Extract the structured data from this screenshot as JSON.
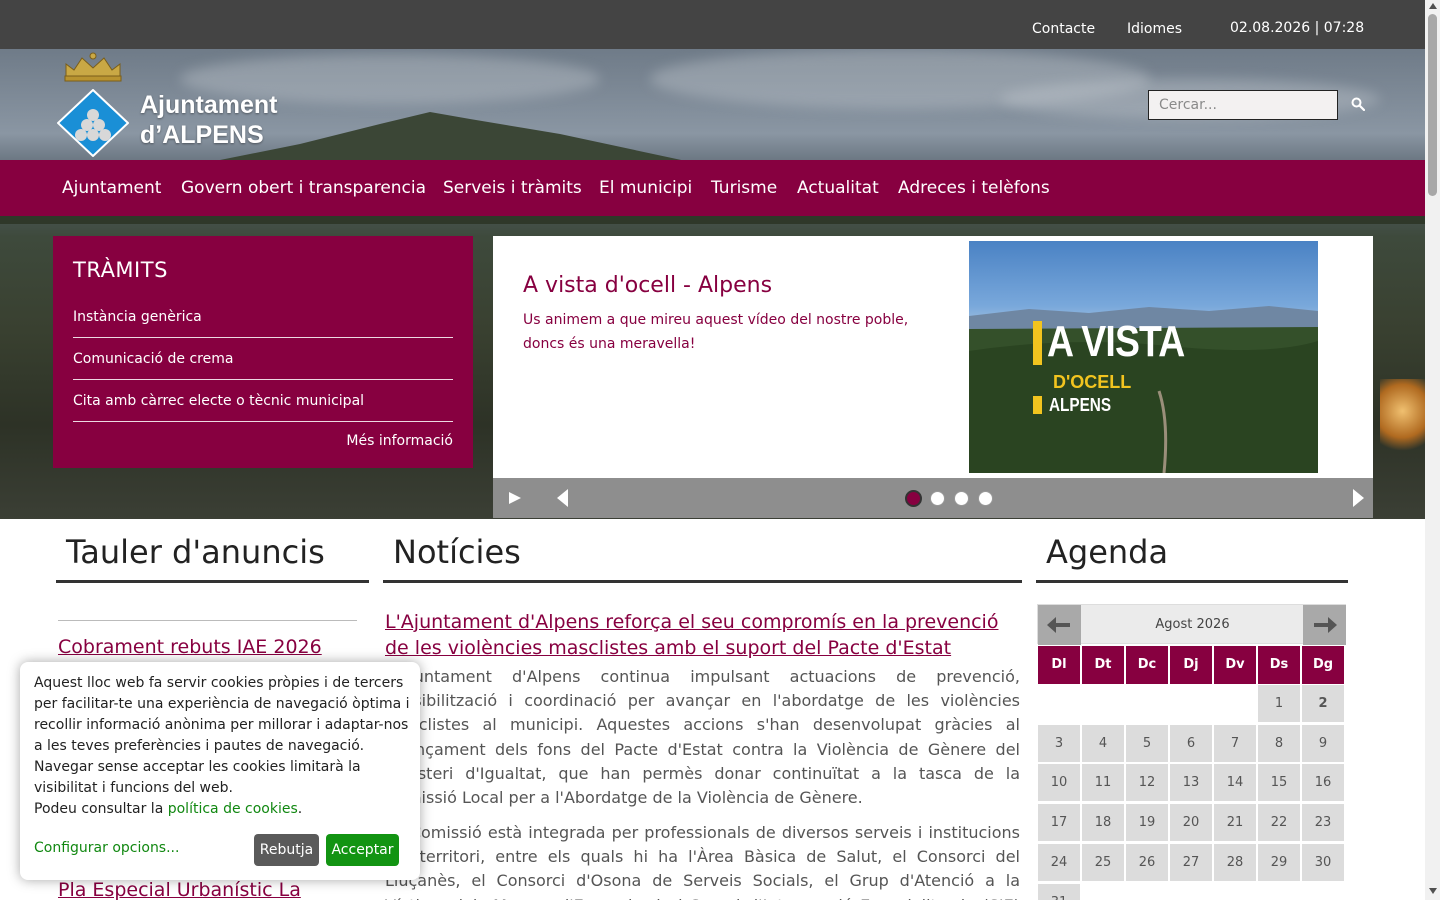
{
  "topbar": {
    "contact_label": "Contacte",
    "languages_label": "Idiomes",
    "datetime": "02.08.2026 | 07:28"
  },
  "header": {
    "logo_line1": "Ajuntament",
    "logo_line2": "d’ALPENS",
    "search_placeholder": "Cercar...",
    "search_icon": "search-icon"
  },
  "nav": {
    "items": [
      "Ajuntament",
      "Govern obert i transparencia",
      "Serveis i tràmits",
      "El municipi",
      "Turisme",
      "Actualitat",
      "Adreces i telèfons"
    ]
  },
  "tramits": {
    "title": "TRÀMITS",
    "items": [
      "Instància genèrica",
      "Comunicació de crema",
      "Cita amb càrrec electe o tècnic municipal"
    ],
    "more_label": "Més informació"
  },
  "slider": {
    "title": "A vista d'ocell - Alpens",
    "description": "Us animem a que mireu aquest vídeo del nostre poble, doncs és una meravella!",
    "image_text": {
      "line1": "A VISTA",
      "line2": "D'OCELL",
      "line3": "ALPENS"
    },
    "dot_count": 4,
    "active_dot": 0
  },
  "tauler": {
    "heading": "Tauler d'anuncis",
    "items": [
      "Cobrament rebuts IAE 2026",
      "Pla Especial Urbanístic La"
    ]
  },
  "noticies": {
    "heading": "Notícies",
    "title": "L'Ajuntament d'Alpens reforça el seu compromís en la prevenció de les violències masclistes amb el suport del Pacte d'Estat",
    "paragraph1": "L'Ajuntament d'Alpens continua impulsant actuacions de prevenció, sensibilització i coordinació per avançar en l'abordatge de les violències masclistes al municipi. Aquestes accions s'han desenvolupat gràcies al finançament dels fons del Pacte d'Estat contra la Violència de Gènere del Ministeri d'Igualtat, que han permès donar continuïtat a la tasca de la Comissió Local per a l'Abordatge de la Violència de Gènere.",
    "paragraph2": "La Comissió està integrada per professionals de diversos serveis i institucions del territori, entre els quals hi ha l'Àrea Bàsica de Salut, el Consorci del Lluçanès, el Consorci d'Osona de Serveis Socials, el Grup d'Atenció a la Víctima dels Mossos d'Esquadra i el Servei d'Intervenció Especialitzada (SIE) de"
  },
  "agenda": {
    "heading": "Agenda",
    "month_label": "Agost 2026",
    "weekdays": [
      "Dl",
      "Dt",
      "Dc",
      "Dj",
      "Dv",
      "Ds",
      "Dg"
    ],
    "first_weekday_index": 5,
    "days_in_month": 31,
    "today": 2
  },
  "cookie": {
    "text": "Aquest lloc web fa servir cookies pròpies i de tercers per facilitar-te una experiència de navegació òptima i recollir informació anònima per millorar i adaptar-nos a les teves preferències i pautes de navegació. Navegar sense acceptar les cookies limitarà la visibilitat i funcions del web.",
    "policy_prefix": "Podeu consultar la",
    "policy_link": "política de cookies",
    "policy_suffix": ".",
    "configure_label": "Configurar opcions...",
    "reject_label": "Rebutja",
    "accept_label": "Acceptar"
  },
  "colors": {
    "brand": "#870040",
    "topbar": "#444444",
    "accept_green": "#129412"
  }
}
